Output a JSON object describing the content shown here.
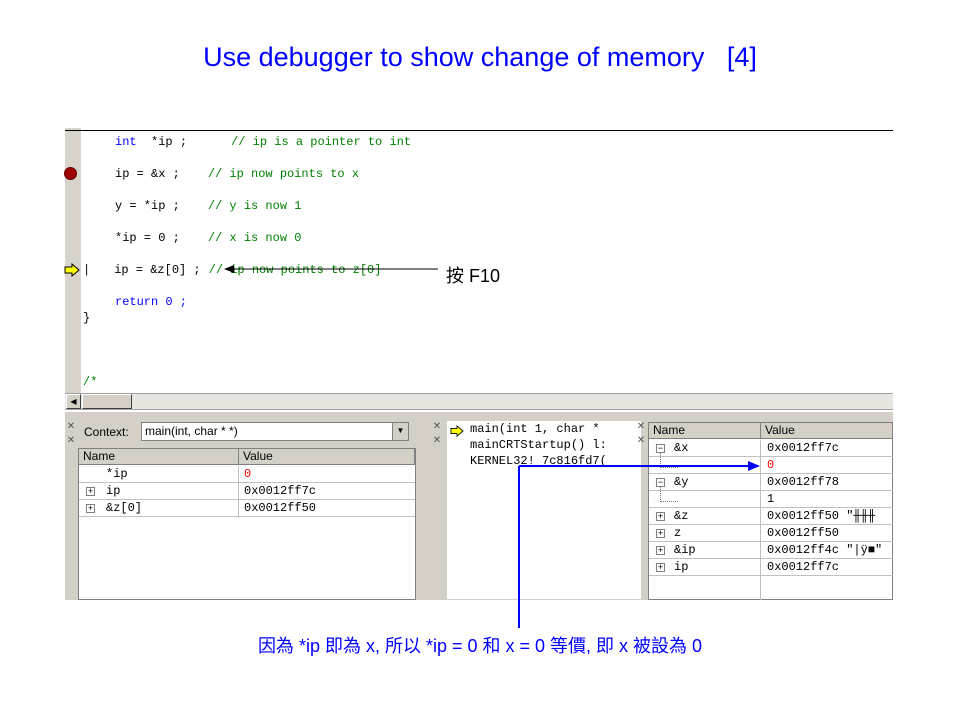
{
  "slide": {
    "title": "Use debugger to show change of memory   [4]",
    "annotation_f10": "按 F10",
    "bottom_note": "因為 *ip 即為 x, 所以 *ip = 0 和 x = 0 等價, 即 x 被設為 0"
  },
  "editor": {
    "lines": [
      {
        "code": "int  *ip ;",
        "comment": "// ip is a pointer to int",
        "kw": "int"
      },
      {
        "code": "ip = &x ;",
        "comment": "// ip now points to x"
      },
      {
        "code": "y = *ip ;",
        "comment": "// y is now 1"
      },
      {
        "code": "*ip = 0 ;",
        "comment": "// x is now 0"
      },
      {
        "code": "ip = &z[0] ;",
        "comment": "// ip now points to z[0]"
      },
      {
        "code": "return 0 ;"
      },
      {
        "code": "}"
      },
      {
        "code": "/*"
      }
    ]
  },
  "variables": {
    "context_label": "Context:",
    "context_value": "main(int, char * *)",
    "headers": [
      "Name",
      "Value"
    ],
    "rows": [
      {
        "name": "*ip",
        "value": "0"
      },
      {
        "name": "ip",
        "value": "0x0012ff7c"
      },
      {
        "name": "&z[0]",
        "value": "0x0012ff50"
      }
    ]
  },
  "callstack": {
    "lines": [
      "main(int 1, char *",
      "mainCRTStartup() l:",
      "KERNEL32! 7c816fd7("
    ]
  },
  "watch": {
    "headers": [
      "Name",
      "Value"
    ],
    "rows": [
      {
        "name": "&x",
        "value": "0x0012ff7c"
      },
      {
        "name": "",
        "value": "0"
      },
      {
        "name": "&y",
        "value": "0x0012ff78"
      },
      {
        "name": "",
        "value": "1"
      },
      {
        "name": "&z",
        "value": "0x0012ff50 \"╫╫╫"
      },
      {
        "name": "z",
        "value": "0x0012ff50"
      },
      {
        "name": "&ip",
        "value": "0x0012ff4c \"|ÿ■\""
      },
      {
        "name": "ip",
        "value": "0x0012ff7c"
      }
    ]
  },
  "colors": {
    "title": "#0000ff",
    "keyword": "#0000ff",
    "comment": "#008000",
    "changed_value": "#ff0000",
    "breakpoint": "#a00000"
  }
}
